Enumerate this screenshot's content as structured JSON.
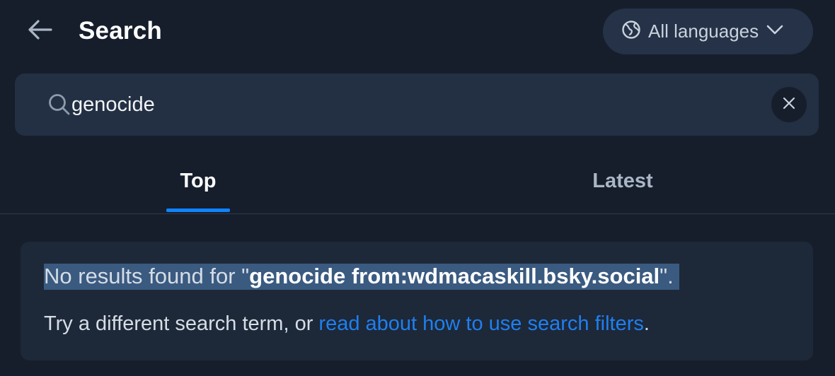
{
  "header": {
    "title": "Search",
    "back_icon": "arrow-left-icon",
    "language_label": "All languages",
    "language_icon": "globe-icon",
    "chevron_icon": "chevron-down-icon"
  },
  "search": {
    "value": "genocide",
    "search_icon": "search-icon",
    "clear_icon": "close-icon"
  },
  "tabs": [
    {
      "label": "Top",
      "active": true
    },
    {
      "label": "Latest",
      "active": false
    }
  ],
  "result": {
    "prefix": "No results found for \"",
    "query": "genocide from:wdmacaskill.bsky.social",
    "suffix": "\".",
    "hint_text": "Try a different search term, or ",
    "hint_link": "read about how to use search filters",
    "hint_end": "."
  },
  "colors": {
    "background": "#161e2c",
    "accent": "#1083fe",
    "link": "#1f7ff0",
    "highlight": "#3a5a80"
  }
}
